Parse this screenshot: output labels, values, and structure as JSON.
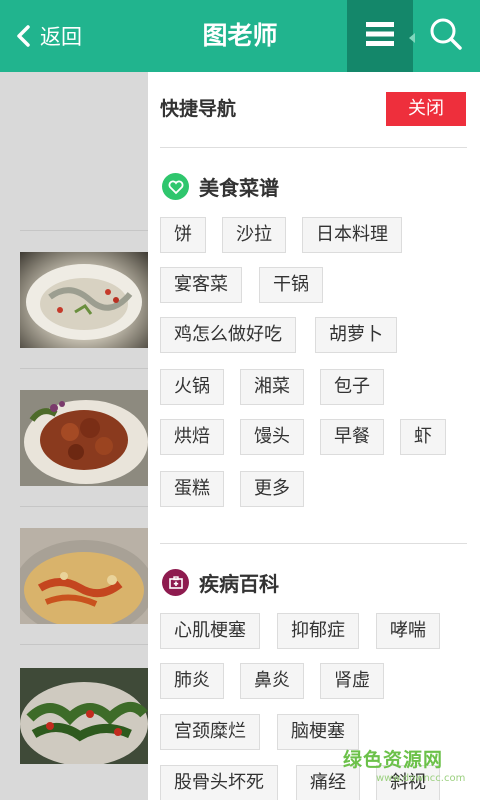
{
  "header": {
    "back_label": "返回",
    "title": "图老师",
    "back_icon": "chevron-left-icon",
    "menu_icon": "hamburger-menu-icon",
    "search_icon": "search-icon",
    "color": "#21b48e"
  },
  "drawer": {
    "heading": "快捷导航",
    "close_label": "关闭",
    "sections": [
      {
        "title": "美食菜谱",
        "icon": "heart-icon",
        "icon_color": "#2fc66d",
        "tags": [
          "饼",
          "沙拉",
          "日本料理",
          "宴客菜",
          "干锅",
          "鸡怎么做好吃",
          "胡萝卜",
          "火锅",
          "湘菜",
          "包子",
          "烘焙",
          "馒头",
          "早餐",
          "虾",
          "蛋糕",
          "更多"
        ]
      },
      {
        "title": "疾病百科",
        "icon": "medical-kit-icon",
        "icon_color": "#8e1b4f",
        "tags": [
          "心肌梗塞",
          "抑郁症",
          "哮喘",
          "肺炎",
          "鼻炎",
          "肾虚",
          "宫颈糜烂",
          "脑梗塞",
          "股骨头坏死",
          "痛经",
          "斜视"
        ]
      }
    ]
  },
  "watermark": {
    "text": "绿色资源网",
    "sub": "www.downcc.com"
  }
}
